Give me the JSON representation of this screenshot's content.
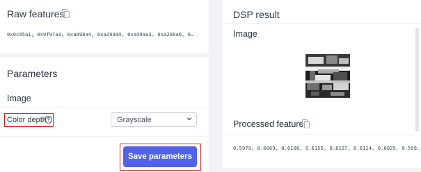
{
  "raw_features": {
    "title": "Raw features",
    "values": "0x9c95a1, 0x9f97a3, 0xa098a4, 0xa299a4, 0xa49aa3, 0xa298a0, 0…"
  },
  "parameters": {
    "title": "Parameters",
    "section": "Image",
    "color_depth_label": "Color depth",
    "color_depth_value": "Grayscale",
    "color_depth_options": [
      "Grayscale"
    ],
    "save_label": "Save parameters"
  },
  "dsp": {
    "title": "DSP result",
    "image_label": "Image",
    "processed_title": "Processed features",
    "processed_values": "0.5979, 0.6069, 0.6108, 0.6155, 0.6197, 0.6114, 0.6029, 0.599…"
  },
  "icons": {
    "copy": "copy-icon",
    "help": "help-circle-icon",
    "dropdown": "chevron-down-icon"
  },
  "colors": {
    "accent": "#5262e8",
    "highlight": "#d6232c",
    "background": "#f1f2f6"
  }
}
